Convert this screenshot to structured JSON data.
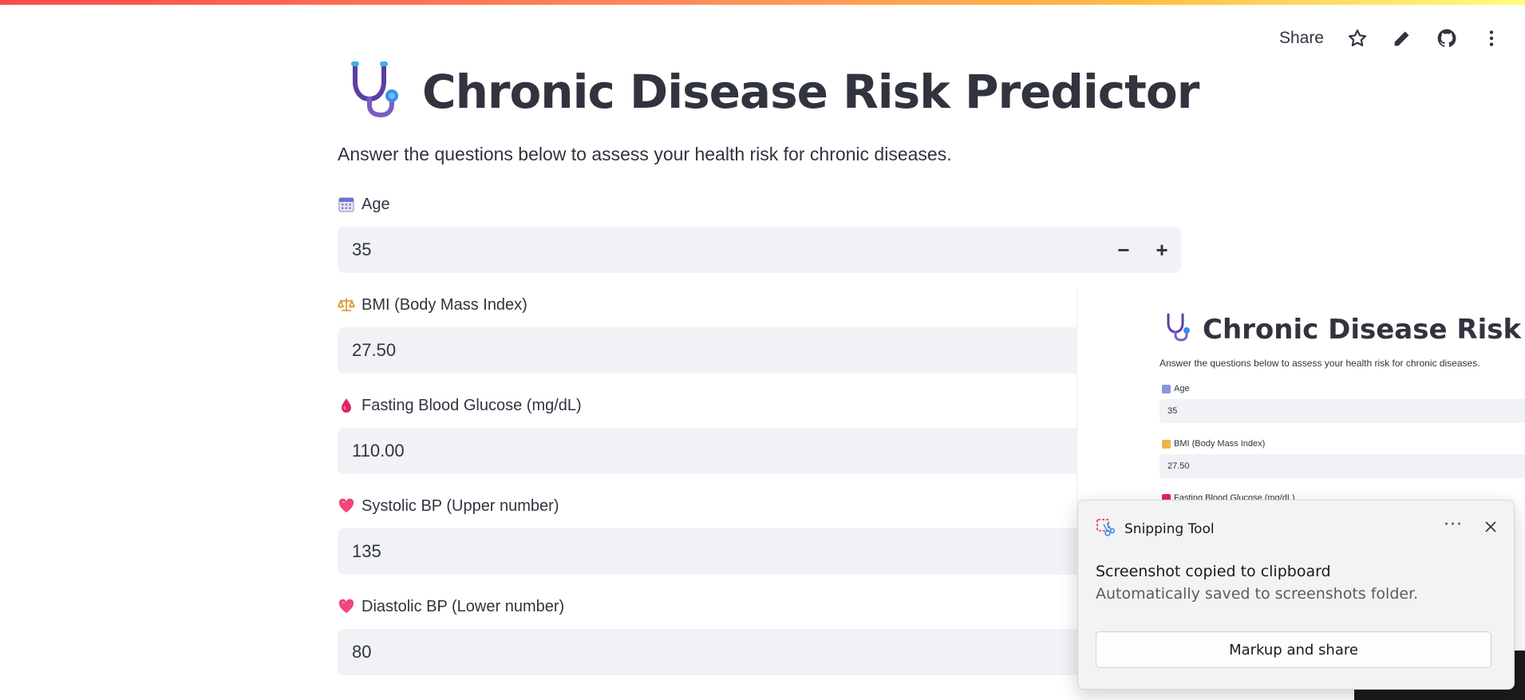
{
  "toolbar": {
    "share_label": "Share",
    "icons": [
      "star-icon",
      "edit-pencil-icon",
      "github-icon",
      "more-vertical-icon"
    ]
  },
  "header": {
    "title": "Chronic Disease Risk Predictor",
    "title_icon": "stethoscope-icon",
    "subtitle": "Answer the questions below to assess your health risk for chronic diseases."
  },
  "form": {
    "fields": [
      {
        "label": "Age",
        "icon": "calendar-icon",
        "value": "35",
        "has_stepper": true
      },
      {
        "label": "BMI (Body Mass Index)",
        "icon": "balance-scale-icon",
        "value": "27.50"
      },
      {
        "label": "Fasting Blood Glucose (mg/dL)",
        "icon": "blood-drop-icon",
        "value": "110.00"
      },
      {
        "label": "Systolic BP (Upper number)",
        "icon": "heart-icon",
        "value": "135"
      },
      {
        "label": "Diastolic BP (Lower number)",
        "icon": "heart-icon",
        "value": "80"
      }
    ],
    "stepper": {
      "minus": "−",
      "plus": "+"
    }
  },
  "preview": {
    "title": "Chronic Disease Risk Pre",
    "subtitle": "Answer the questions below to assess your health risk for chronic diseases.",
    "fields": [
      {
        "label": "Age",
        "value": "35"
      },
      {
        "label": "BMI (Body Mass Index)",
        "value": "27.50"
      },
      {
        "label": "Fasting Blood Glucose (mg/dL)"
      }
    ]
  },
  "toast": {
    "app_name": "Snipping Tool",
    "more_label": "···",
    "message": "Screenshot copied to clipboard",
    "detail": "Automatically saved to screenshots folder.",
    "button_label": "Markup and share"
  },
  "colors": {
    "accent_gradient": [
      "#ff4b4b",
      "#ffbd45",
      "#fffd80"
    ],
    "input_bg": "#f0f2f6",
    "text": "#31333f"
  }
}
